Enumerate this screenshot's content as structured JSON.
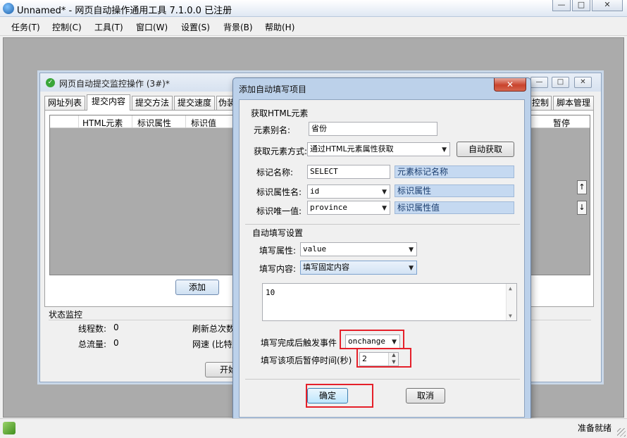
{
  "app": {
    "title": "Unnamed* - 网页自动操作通用工具 7.1.0.0  已注册",
    "win_buttons": [
      "—",
      "□",
      "✕"
    ]
  },
  "menu": [
    "任务(T)",
    "控制(C)",
    "工具(T)",
    "窗口(W)",
    "设置(S)",
    "背景(B)",
    "帮助(H)"
  ],
  "child": {
    "title": "网页自动提交监控操作  (3#)*",
    "win_buttons": [
      "—",
      "□",
      "✕"
    ],
    "tabs": [
      "网址列表",
      "提交内容",
      "提交方法",
      "提交速度",
      "伪装"
    ],
    "tabs_right": [
      "控制",
      "脚本管理"
    ],
    "grid_headers": [
      "HTML元素",
      "标识属性",
      "标识值",
      "暂停"
    ],
    "add_label": "添加",
    "arrow_up": "↑",
    "arrow_down": "↓",
    "status": {
      "title": "状态监控",
      "threads_label": "线程数:",
      "threads_value": "0",
      "traffic_label": "总流量:",
      "traffic_value": "0",
      "refresh_label": "刷新总次数",
      "speed_label": "网速 (比特/",
      "start_label": "开始"
    }
  },
  "dialog": {
    "title": "添加自动填写项目",
    "close": "✕",
    "group1": {
      "title": "获取HTML元素",
      "alias_label": "元素别名:",
      "alias_value": "省份",
      "method_label": "获取元素方式:",
      "method_value": "通过HTML元素属性获取",
      "auto_get": "自动获取",
      "tag_label": "标记名称:",
      "tag_value": "SELECT",
      "tag_hint": "元素标记名称",
      "attr_label": "标识属性名:",
      "attr_value": "id",
      "attr_hint": "标识属性",
      "unique_label": "标识唯一值:",
      "unique_value": "province",
      "unique_hint": "标识属性值"
    },
    "group2": {
      "title": "自动填写设置",
      "fill_attr_label": "填写属性:",
      "fill_attr_value": "value",
      "fill_content_label": "填写内容:",
      "fill_content_value": "填写固定内容",
      "content_text": "10",
      "event_label": "填写完成后触发事件",
      "event_value": "onchange",
      "pause_label": "填写该项后暂停时间(秒)",
      "pause_value": "2"
    },
    "ok": "确定",
    "cancel": "取消"
  },
  "statusbar": {
    "ready": "准备就绪"
  },
  "colors": {
    "highlight_border": "#e5202a",
    "hint_fill": "#c5d9f1",
    "close_red": "#c9432c"
  }
}
